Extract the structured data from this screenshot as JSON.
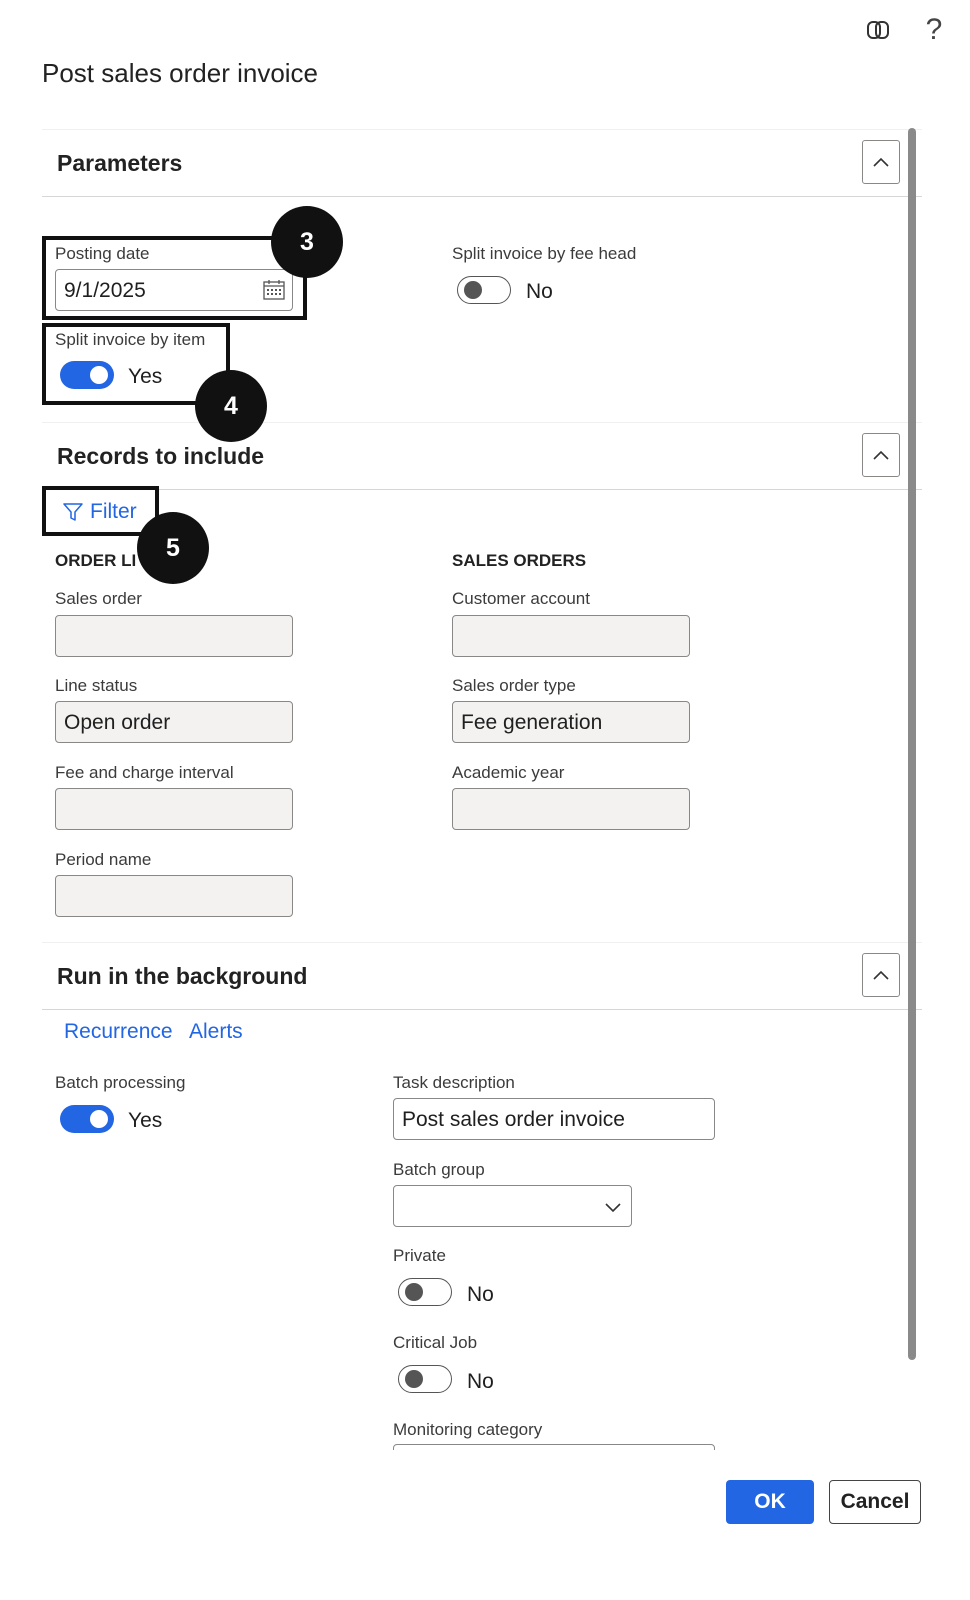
{
  "dialog": {
    "title": "Post sales order invoice"
  },
  "header_icons": {
    "copilot": "copilot-icon",
    "help": "?"
  },
  "parameters": {
    "title": "Parameters",
    "posting_date": {
      "label": "Posting date",
      "value": "9/1/2025"
    },
    "split_by_item": {
      "label": "Split invoice by item",
      "state": "Yes"
    },
    "split_by_fee_head": {
      "label": "Split invoice by fee head",
      "state": "No"
    }
  },
  "records": {
    "title": "Records to include",
    "filter_label": "Filter",
    "order_lines": {
      "heading": "ORDER LI",
      "sales_order": {
        "label": "Sales order",
        "value": ""
      },
      "line_status": {
        "label": "Line status",
        "value": "Open order"
      },
      "fee_interval": {
        "label": "Fee and charge interval",
        "value": ""
      },
      "period_name": {
        "label": "Period name",
        "value": ""
      }
    },
    "sales_orders": {
      "heading": "SALES ORDERS",
      "customer_account": {
        "label": "Customer account",
        "value": ""
      },
      "sales_order_type": {
        "label": "Sales order type",
        "value": "Fee generation"
      },
      "academic_year": {
        "label": "Academic year",
        "value": ""
      }
    }
  },
  "background": {
    "title": "Run in the background",
    "tabs": [
      "Recurrence",
      "Alerts"
    ],
    "batch_processing": {
      "label": "Batch processing",
      "state": "Yes"
    },
    "task_description": {
      "label": "Task description",
      "value": "Post sales order invoice"
    },
    "batch_group": {
      "label": "Batch group",
      "value": ""
    },
    "private": {
      "label": "Private",
      "state": "No"
    },
    "critical_job": {
      "label": "Critical Job",
      "state": "No"
    },
    "monitoring_category": {
      "label": "Monitoring category"
    }
  },
  "callouts": [
    "3",
    "4",
    "5"
  ],
  "buttons": {
    "ok": "OK",
    "cancel": "Cancel"
  },
  "colors": {
    "accent": "#2266e3",
    "callout": "#111111"
  }
}
